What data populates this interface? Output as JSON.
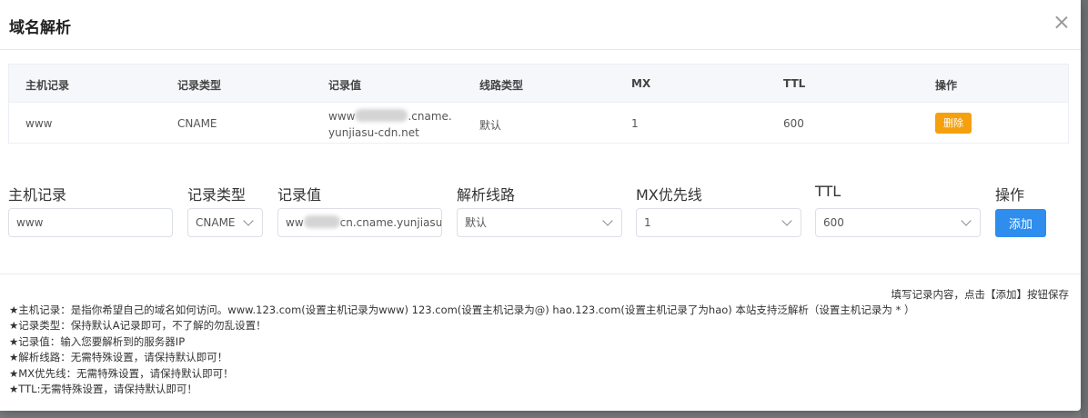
{
  "dialog": {
    "title": "域名解析"
  },
  "table": {
    "headers": [
      "主机记录",
      "记录类型",
      "记录值",
      "线路类型",
      "MX",
      "TTL",
      "操作"
    ],
    "row": {
      "host": "www",
      "type": "CNAME",
      "value_prefix": "www",
      "value_suffix": ".cname.yunjiasu-cdn.net",
      "line": "默认",
      "mx": "1",
      "ttl": "600",
      "delete_label": "删除"
    }
  },
  "form": {
    "labels": {
      "host": "主机记录",
      "type": "记录类型",
      "value": "记录值",
      "line": "解析线路",
      "mx": "MX优先线",
      "ttl": "TTL",
      "action": "操作"
    },
    "host_value": "www",
    "type_value": "CNAME",
    "value_prefix": "ww",
    "value_suffix": "cn.cname.yunjiasu",
    "line_value": "默认",
    "mx_value": "1",
    "ttl_value": "600",
    "add_label": "添加"
  },
  "hint": "填写记录内容，点击【添加】按钮保存",
  "help": [
    "★主机记录：是指你希望自己的域名如何访问。www.123.com(设置主机记录为www) 123.com(设置主机记录为@) hao.123.com(设置主机记录了为hao) 本站支持泛解析（设置主机记录为 * ）",
    "★记录类型：保持默认A记录即可，不了解的勿乱设置！",
    "★记录值：输入您要解析到的服务器IP",
    "★解析线路：无需特殊设置，请保持默认即可！",
    "★MX优先线：无需特殊设置，请保持默认即可！",
    "★TTL:无需特殊设置，请保持默认即可！"
  ]
}
